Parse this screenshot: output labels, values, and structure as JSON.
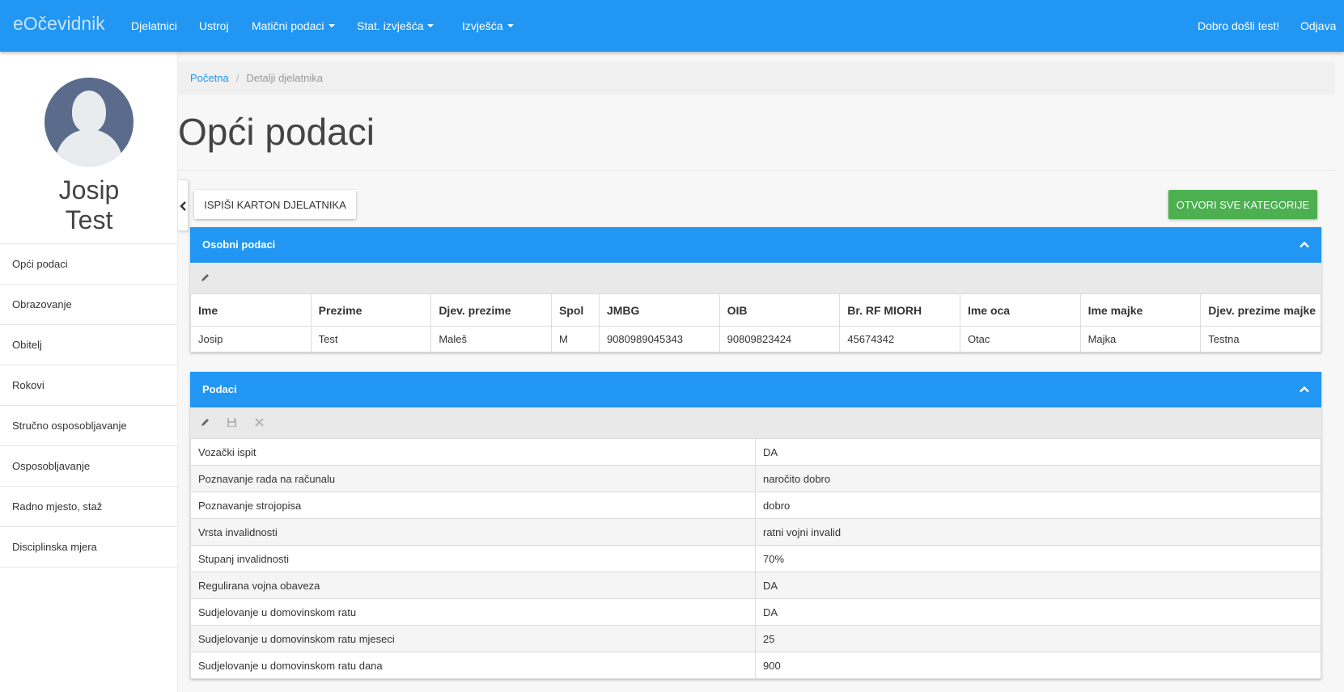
{
  "navbar": {
    "brand": "eOčevidnik",
    "items": [
      {
        "label": "Djelatnici",
        "dropdown": false
      },
      {
        "label": "Ustroj",
        "dropdown": false
      },
      {
        "label": "Matični podaci",
        "dropdown": true
      },
      {
        "label": "Stat. izvješća",
        "dropdown": true
      },
      {
        "label": "Izvješća",
        "dropdown": true
      }
    ],
    "welcome": "Dobro došli test!",
    "logout": "Odjava",
    "color": "#2196f3"
  },
  "sidebar": {
    "user_first_name": "Josip",
    "user_last_name": "Test",
    "menu": [
      {
        "label": "Opći podaci"
      },
      {
        "label": "Obrazovanje"
      },
      {
        "label": "Obitelj"
      },
      {
        "label": "Rokovi"
      },
      {
        "label": "Stručno osposobljavanje"
      },
      {
        "label": "Osposobljavanje"
      },
      {
        "label": "Radno mjesto, staž"
      },
      {
        "label": "Disciplinska mjera"
      }
    ]
  },
  "breadcrumb": {
    "home": "Početna",
    "separator": "/",
    "current": "Detalji djelatnika"
  },
  "page_title": "Opći podaci",
  "actions": {
    "print_label": "Ispiši karton djelatnika",
    "open_all_label": "Otvori sve kategorije",
    "open_all_color": "#4caf50"
  },
  "personal_panel": {
    "title": "Osobni podaci",
    "headers": [
      "Ime",
      "Prezime",
      "Djev. prezime",
      "Spol",
      "JMBG",
      "OIB",
      "Br. RF MIORH",
      "Ime oca",
      "Ime majke",
      "Djev. prezime majke"
    ],
    "row": [
      "Josip",
      "Test",
      "Maleš",
      "M",
      "9080989045343",
      "90809823424",
      "45674342",
      "Otac",
      "Majka",
      "Testna"
    ]
  },
  "data_panel": {
    "title": "Podaci",
    "rows": [
      {
        "label": "Vozački ispit",
        "value": "DA"
      },
      {
        "label": "Poznavanje rada na računalu",
        "value": "naročito dobro"
      },
      {
        "label": "Poznavanje strojopisa",
        "value": "dobro"
      },
      {
        "label": "Vrsta invalidnosti",
        "value": "ratni vojni invalid"
      },
      {
        "label": "Stupanj invalidnosti",
        "value": "70%"
      },
      {
        "label": "Regulirana vojna obaveza",
        "value": "DA"
      },
      {
        "label": "Sudjelovanje u domovinskom ratu",
        "value": "DA"
      },
      {
        "label": "Sudjelovanje u domovinskom ratu mjeseci",
        "value": "25"
      },
      {
        "label": "Sudjelovanje u domovinskom ratu dana",
        "value": "900"
      }
    ]
  },
  "icons": {
    "edit": "pencil-icon",
    "save": "floppy-icon",
    "cancel": "close-icon",
    "collapse_panel": "chevron-up-icon",
    "collapse_sidebar": "chevron-left-icon",
    "avatar": "user-silhouette-icon"
  }
}
